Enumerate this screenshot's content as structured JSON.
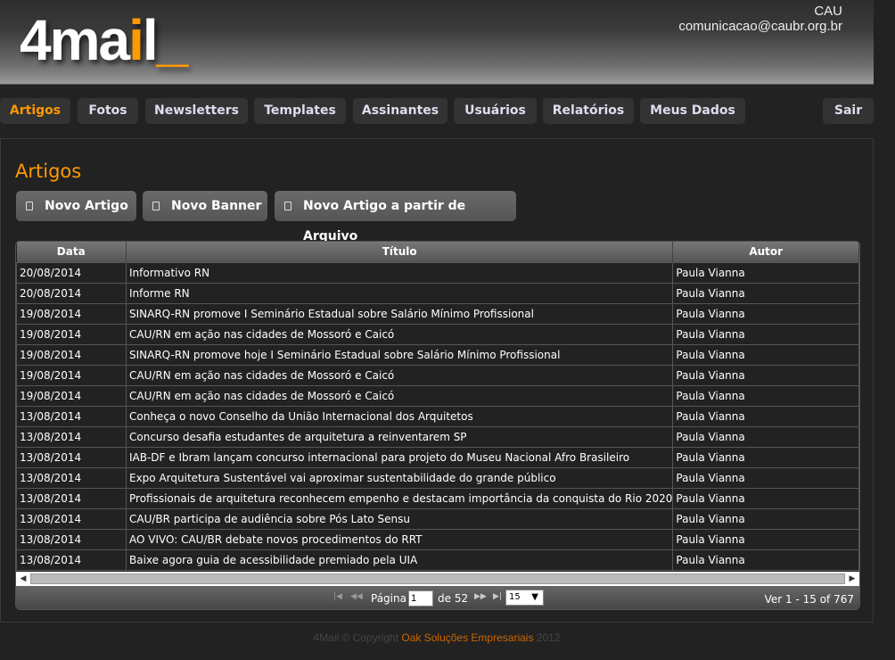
{
  "header": {
    "logo": "4mail",
    "account": "CAU",
    "email": "comunicacao@caubr.org.br"
  },
  "nav": {
    "tabs": [
      {
        "label": "Artigos",
        "active": true
      },
      {
        "label": "Fotos"
      },
      {
        "label": "Newsletters"
      },
      {
        "label": "Templates"
      },
      {
        "label": "Assinantes"
      },
      {
        "label": "Usuários"
      },
      {
        "label": "Relatórios"
      },
      {
        "label": "Meus Dados"
      }
    ],
    "logout": "Sair"
  },
  "page": {
    "title": "Artigos"
  },
  "actions": {
    "new_article": "Novo Artigo",
    "new_banner": "Novo Banner",
    "new_from_file": "Novo Artigo a partir de Arquivo",
    "icon": "document-icon"
  },
  "table": {
    "columns": [
      "Data",
      "Título",
      "Autor"
    ],
    "rows": [
      [
        "20/08/2014",
        "Informativo RN",
        "Paula Vianna"
      ],
      [
        "20/08/2014",
        "Informe RN",
        "Paula Vianna"
      ],
      [
        "19/08/2014",
        "SINARQ-RN promove I Seminário Estadual sobre Salário Mínimo Profissional",
        "Paula Vianna"
      ],
      [
        "19/08/2014",
        "CAU/RN em ação nas cidades de Mossoró e Caicó",
        "Paula Vianna"
      ],
      [
        "19/08/2014",
        "SINARQ-RN promove hoje I Seminário Estadual sobre Salário Mínimo Profissional",
        "Paula Vianna"
      ],
      [
        "19/08/2014",
        "CAU/RN em ação nas cidades de Mossoró e Caicó",
        "Paula Vianna"
      ],
      [
        "19/08/2014",
        "CAU/RN em ação nas cidades de Mossoró e Caicó",
        "Paula Vianna"
      ],
      [
        "13/08/2014",
        "Conheça o novo Conselho da União Internacional dos Arquitetos",
        "Paula Vianna"
      ],
      [
        "13/08/2014",
        "Concurso desafia estudantes de arquitetura a reinventarem SP",
        "Paula Vianna"
      ],
      [
        "13/08/2014",
        "IAB-DF e Ibram lançam concurso internacional para projeto do Museu Nacional Afro Brasileiro",
        "Paula Vianna"
      ],
      [
        "13/08/2014",
        "Expo Arquitetura Sustentável vai aproximar sustentabilidade do grande público",
        "Paula Vianna"
      ],
      [
        "13/08/2014",
        "Profissionais de arquitetura reconhecem empenho e destacam importância da conquista do Rio 2020",
        "Paula Vianna"
      ],
      [
        "13/08/2014",
        "CAU/BR participa de audiência sobre Pós Lato Sensu",
        "Paula Vianna"
      ],
      [
        "13/08/2014",
        "AO VIVO: CAU/BR debate novos procedimentos do RRT",
        "Paula Vianna"
      ],
      [
        "13/08/2014",
        "Baixe agora guia de acessibilidade premiado pela UIA",
        "Paula Vianna"
      ]
    ]
  },
  "pager": {
    "page_label": "Página",
    "page": "1",
    "of_label": "de 52",
    "page_size": "15",
    "summary": "Ver 1 - 15 of 767"
  },
  "footer": {
    "prefix": "4Mail © Copyright",
    "company": "Oak Soluções Empresariais",
    "year": "2012"
  },
  "colors": {
    "accent": "#ff9900",
    "background": "#222222"
  }
}
